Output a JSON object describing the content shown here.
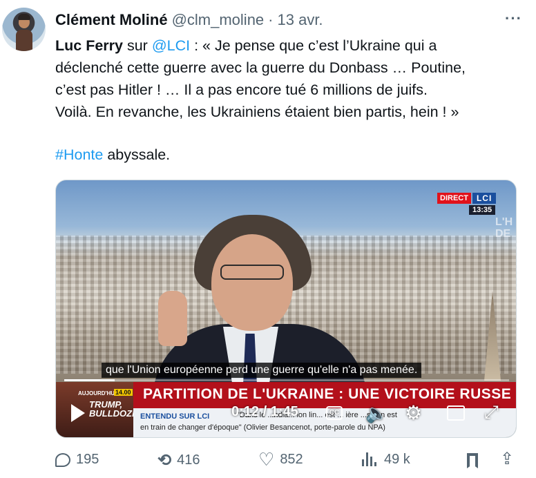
{
  "tweet": {
    "author_name": "Clément Moliné",
    "handle": "@clm_moline",
    "separator": "·",
    "date": "13 avr.",
    "more_label": "···",
    "text_lines": [
      {
        "prefix_bold": "Luc Ferry",
        "mid": " sur ",
        "mention": "@LCI",
        "rest": " : « Je pense que c’est l’Ukraine qui a"
      },
      "déclenché cette guerre avec la guerre du Donbass … Poutine,",
      "c’est pas Hitler ! … Il a pas encore tué 6 millions de juifs.",
      "Voilà. En revanche, les Ukrainiens étaient bien partis, hein ! »"
    ],
    "hashtag": "#Honte",
    "hashtag_rest": " abyssale."
  },
  "video": {
    "live_label": "DIRECT",
    "channel": "LCI",
    "clock": "13:35",
    "side_logo": "L'H\nDE",
    "subtitle": "que l'Union européenne perd une guerre qu'elle n'a pas menée.",
    "thumb_label": "AUJOURD'HUI",
    "thumb_time": "14.00",
    "thumb_title": "TRUMP,\nBULLDOZER",
    "headline": "PARTITION DE L'UKRAINE : UNE VICTOIRE RUSSE ?",
    "entendu_label": "ENTENDU SUR LCI",
    "quote_line1": "\"Dans le ...ndia... ion lin... est ... ière ...s. On est",
    "quote_line2": "en train de changer d'époque\" (Olivier Besancenot, porte-parole du NPA)",
    "timecode": "0:12 / 1:45",
    "progress": 0.114,
    "cc_label": "CC"
  },
  "actions": {
    "replies": "195",
    "retweets": "416",
    "likes": "852",
    "views": "49 k"
  },
  "colors": {
    "link": "#1d9bf0",
    "muted": "#536471",
    "banner_red": "#b3101b",
    "lci_blue": "#1a4f9e"
  },
  "icons": [
    "reply-icon",
    "retweet-icon",
    "like-icon",
    "views-icon",
    "bookmark-icon",
    "share-icon",
    "play-icon",
    "cc-icon",
    "volume-icon",
    "settings-icon",
    "pip-icon",
    "fullscreen-icon",
    "more-icon"
  ]
}
